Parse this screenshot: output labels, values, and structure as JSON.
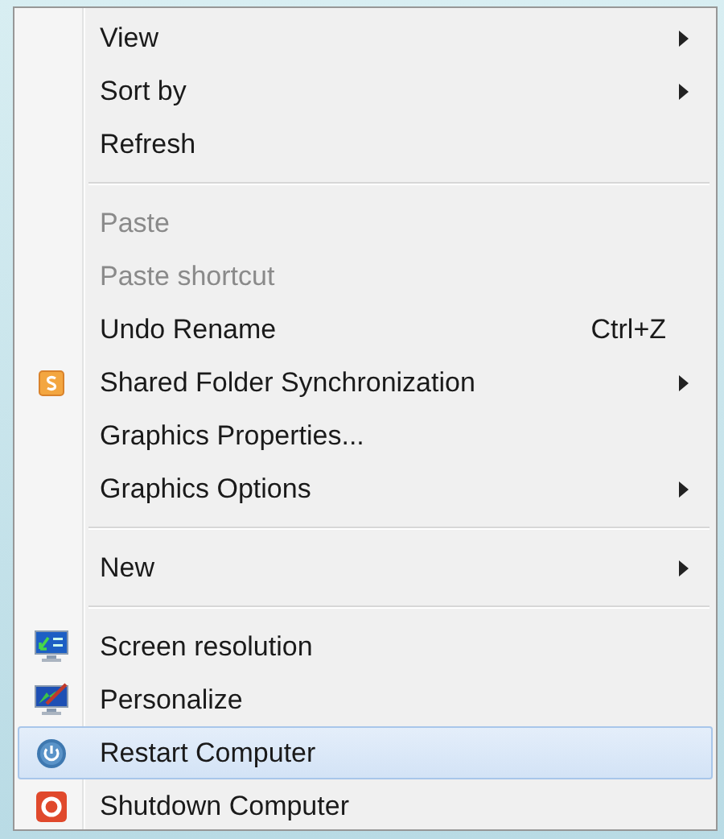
{
  "menu": {
    "items": [
      {
        "kind": "item",
        "label": "View",
        "submenu": true,
        "disabled": false,
        "selected": false
      },
      {
        "kind": "item",
        "label": "Sort by",
        "submenu": true,
        "disabled": false,
        "selected": false
      },
      {
        "kind": "item",
        "label": "Refresh",
        "submenu": false,
        "disabled": false,
        "selected": false
      },
      {
        "kind": "separator"
      },
      {
        "kind": "item",
        "label": "Paste",
        "submenu": false,
        "disabled": true,
        "selected": false
      },
      {
        "kind": "item",
        "label": "Paste shortcut",
        "submenu": false,
        "disabled": true,
        "selected": false
      },
      {
        "kind": "item",
        "label": "Undo Rename",
        "shortcut": "Ctrl+Z",
        "submenu": false,
        "disabled": false,
        "selected": false
      },
      {
        "kind": "item",
        "label": "Shared Folder Synchronization",
        "submenu": true,
        "disabled": false,
        "selected": false
      },
      {
        "kind": "item",
        "label": "Graphics Properties...",
        "submenu": false,
        "disabled": false,
        "selected": false
      },
      {
        "kind": "item",
        "label": "Graphics Options",
        "submenu": true,
        "disabled": false,
        "selected": false
      },
      {
        "kind": "separator"
      },
      {
        "kind": "item",
        "label": "New",
        "submenu": true,
        "disabled": false,
        "selected": false
      },
      {
        "kind": "separator"
      },
      {
        "kind": "item",
        "label": "Screen resolution",
        "submenu": false,
        "disabled": false,
        "selected": false
      },
      {
        "kind": "item",
        "label": "Personalize",
        "submenu": false,
        "disabled": false,
        "selected": false
      },
      {
        "kind": "item",
        "label": "Restart Computer",
        "submenu": false,
        "disabled": false,
        "selected": true
      },
      {
        "kind": "item",
        "label": "Shutdown Computer",
        "submenu": false,
        "disabled": false,
        "selected": false
      }
    ]
  }
}
